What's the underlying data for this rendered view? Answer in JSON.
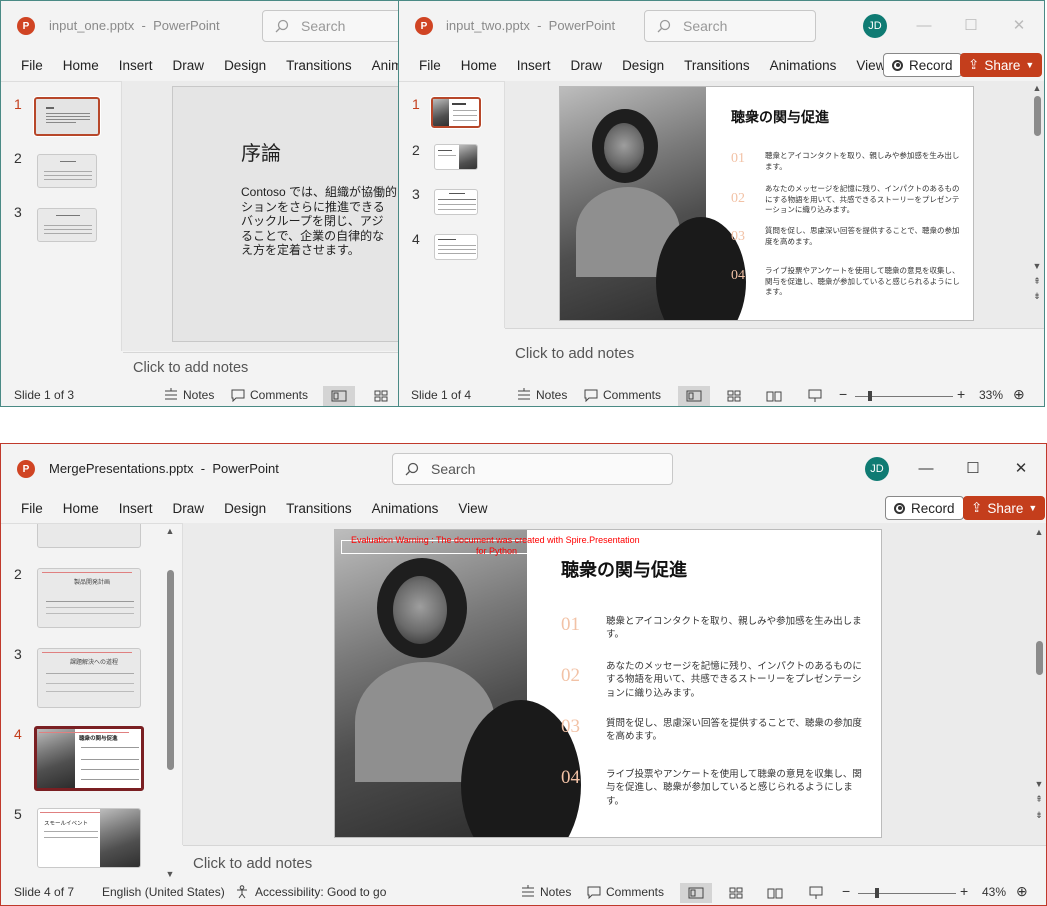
{
  "window1": {
    "filename": "input_one.pptx",
    "title_sep": "-",
    "app": "PowerPoint",
    "search_placeholder": "Search",
    "menu": [
      "File",
      "Home",
      "Insert",
      "Draw",
      "Design",
      "Transitions",
      "Anim"
    ],
    "thumb_numbers": [
      "1",
      "2",
      "3"
    ],
    "slide": {
      "title": "序論",
      "body": "Contoso では、組織が協働的なコミュニケーションをさらに推進できるよう、フィードバックループを閉じ、アジャイルを取り入れることで、企業の自律的な文化と考え方を定着させます。",
      "body_lines": [
        "Contoso では、組織が協働的",
        "ションをさらに推進できる",
        "バックループを閉じ、アジ",
        "ることで、企業の自律的な",
        "え方を定着させます。"
      ]
    },
    "notes_placeholder": "Click to add notes",
    "status": {
      "slide_of": "Slide 1 of 3",
      "notes": "Notes",
      "comments": "Comments"
    }
  },
  "window2": {
    "filename": "input_two.pptx",
    "title_sep": "-",
    "app": "PowerPoint",
    "search_placeholder": "Search",
    "avatar": "JD",
    "menu": [
      "File",
      "Home",
      "Insert",
      "Draw",
      "Design",
      "Transitions",
      "Animations",
      "View"
    ],
    "record_label": "Record",
    "share_label": "Share",
    "thumb_numbers": [
      "1",
      "2",
      "3",
      "4"
    ],
    "notes_placeholder": "Click to add notes",
    "status": {
      "slide_of": "Slide 1 of 4",
      "notes": "Notes",
      "comments": "Comments",
      "zoom": "33%"
    }
  },
  "window3": {
    "filename": "MergePresentations.pptx",
    "title_sep": "-",
    "app": "PowerPoint",
    "search_placeholder": "Search",
    "avatar": "JD",
    "menu": [
      "File",
      "Home",
      "Insert",
      "Draw",
      "Design",
      "Transitions",
      "Animations",
      "View"
    ],
    "record_label": "Record",
    "share_label": "Share",
    "thumb_numbers": [
      "2",
      "3",
      "4",
      "5"
    ],
    "thumb_titles": {
      "t2": "製品開発計画",
      "t3": "課題解決への道程",
      "t4": "聴衆の関与促進",
      "t5": "スモールイベント"
    },
    "notes_placeholder": "Click to add notes",
    "eval_warning_1": "Evaluation Warning : The document was created with Spire.Presentation",
    "eval_warning_2": "for Python",
    "status": {
      "slide_of": "Slide 4 of 7",
      "language": "English (United States)",
      "accessibility": "Accessibility: Good to go",
      "notes": "Notes",
      "comments": "Comments",
      "zoom": "43%"
    }
  },
  "engagement_slide": {
    "title": "聴衆の関与促進",
    "items": [
      {
        "num": "01",
        "text": "聴衆とアイコンタクトを取り、親しみや参加感を生み出します。"
      },
      {
        "num": "02",
        "text": "あなたのメッセージを記憶に残り、インパクトのあるものにする物語を用いて、共感できるストーリーをプレゼンテーションに織り込みます。"
      },
      {
        "num": "03",
        "text": "質問を促し、思慮深い回答を提供することで、聴衆の参加度を高めます。"
      },
      {
        "num": "04",
        "text": "ライブ投票やアンケートを使用して聴衆の意見を収集し、関与を促進し、聴衆が参加していると感じられるようにします。"
      }
    ]
  },
  "colors": {
    "accent": "#c43e1c",
    "selected_thumb": "#7a1f22",
    "avatar": "#0f7b73",
    "number_tint": "#f2c2a6",
    "warning_red": "#ff0000"
  }
}
